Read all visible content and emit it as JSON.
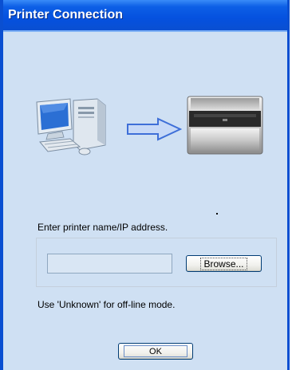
{
  "window": {
    "title": "Printer Connection"
  },
  "colors": {
    "titlebar": "#0a4fd1",
    "window_bg": "#cfe0f3",
    "field_bg": "#d9e6f4"
  },
  "illustration": {
    "computer_icon": "computer-icon",
    "arrow_icon": "right-arrow-icon",
    "printer_icon": "printer-icon"
  },
  "form": {
    "prompt": "Enter printer name/IP address.",
    "ip_value": "",
    "browse_label": "Browse...",
    "note": "Use 'Unknown' for off-line mode.",
    "ok_label": "OK"
  }
}
